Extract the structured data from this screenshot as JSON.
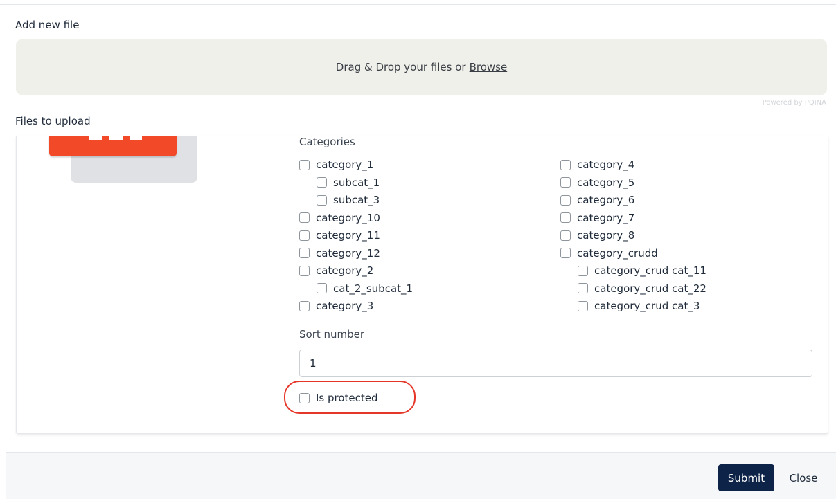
{
  "modal": {
    "add_new_file_label": "Add new file",
    "files_to_upload_label": "Files to upload"
  },
  "dropzone": {
    "text": "Drag & Drop your files or",
    "browse_link": "Browse",
    "powered_by": "Powered by PQINA"
  },
  "file_form": {
    "categories_title": "Categories",
    "categories_left": [
      {
        "label": "category_1",
        "checked": false,
        "level": 0
      },
      {
        "label": "subcat_1",
        "checked": false,
        "level": 1
      },
      {
        "label": "subcat_3",
        "checked": false,
        "level": 1
      },
      {
        "label": "category_10",
        "checked": false,
        "level": 0
      },
      {
        "label": "category_11",
        "checked": false,
        "level": 0
      },
      {
        "label": "category_12",
        "checked": false,
        "level": 0
      },
      {
        "label": "category_2",
        "checked": false,
        "level": 0
      },
      {
        "label": "cat_2_subcat_1",
        "checked": false,
        "level": 1
      },
      {
        "label": "category_3",
        "checked": false,
        "level": 0
      }
    ],
    "categories_right": [
      {
        "label": "category_4",
        "checked": false,
        "level": 0
      },
      {
        "label": "category_5",
        "checked": false,
        "level": 0
      },
      {
        "label": "category_6",
        "checked": false,
        "level": 0
      },
      {
        "label": "category_7",
        "checked": false,
        "level": 0
      },
      {
        "label": "category_8",
        "checked": false,
        "level": 0
      },
      {
        "label": "category_crudd",
        "checked": false,
        "level": 0
      },
      {
        "label": "category_crud cat_11",
        "checked": false,
        "level": 1
      },
      {
        "label": "category_crud cat_22",
        "checked": false,
        "level": 1
      },
      {
        "label": "category_crud cat_3",
        "checked": false,
        "level": 1
      }
    ],
    "sort_number_label": "Sort number",
    "sort_number_value": "1",
    "is_protected_label": "Is protected",
    "is_protected_checked": false
  },
  "footer": {
    "submit_label": "Submit",
    "close_label": "Close"
  },
  "colors": {
    "primary_button": "#0d2348",
    "highlight_ring": "#e5362a",
    "file_thumbnail": "#f24a28",
    "dropzone_bg": "#f0f0eb"
  },
  "icons": {
    "file_thumbnail": "pdf-file-icon"
  }
}
